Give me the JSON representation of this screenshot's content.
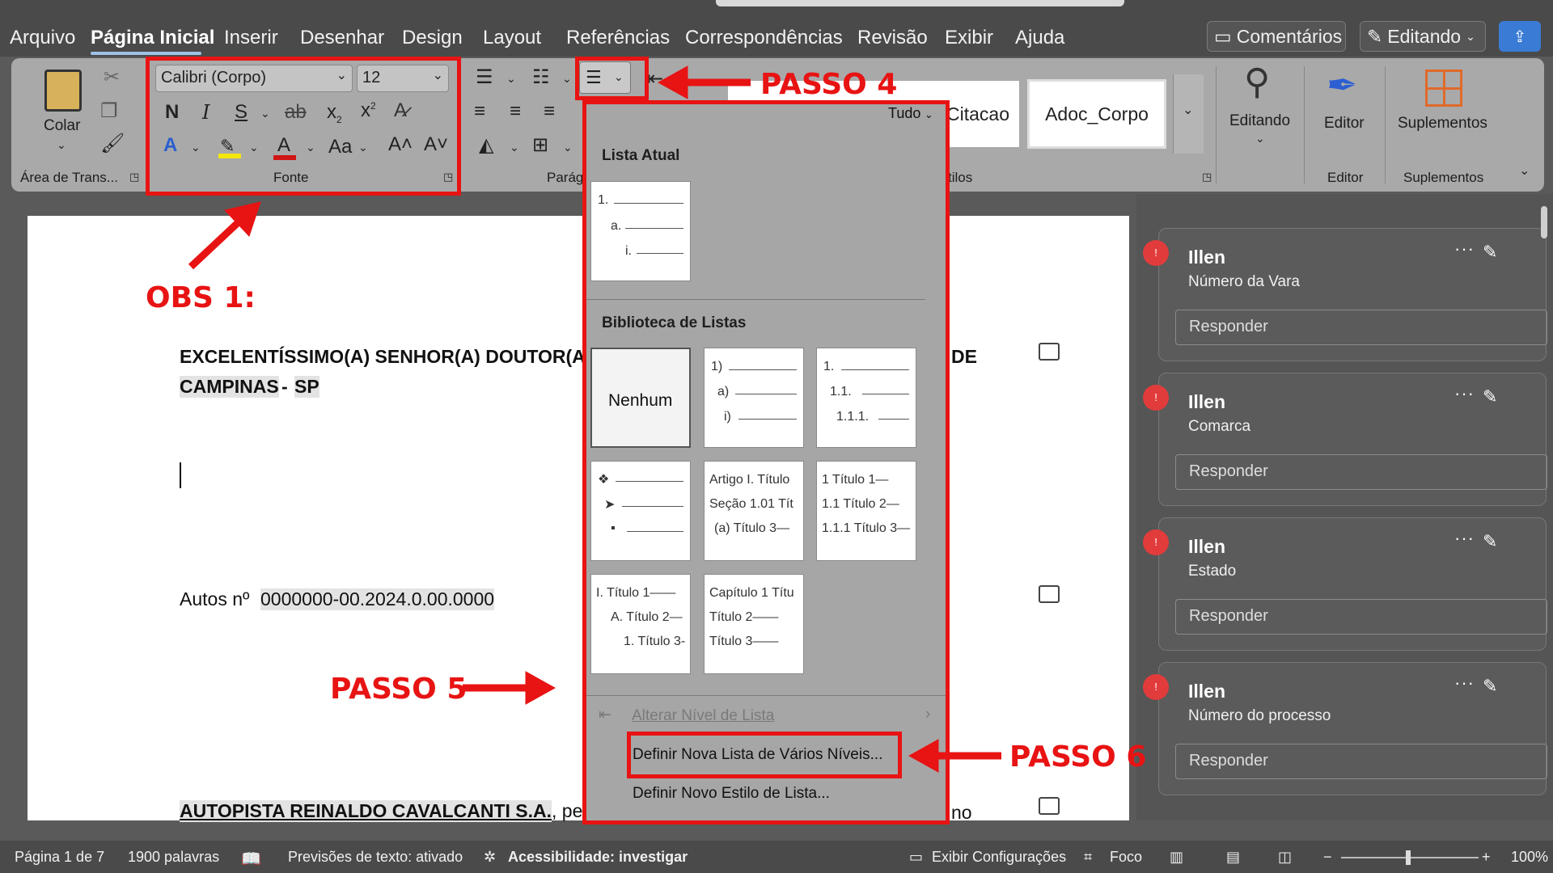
{
  "menu": {
    "tabs": [
      "Arquivo",
      "Página Inicial",
      "Inserir",
      "Desenhar",
      "Design",
      "Layout",
      "Referências",
      "Correspondências",
      "Revisão",
      "Exibir",
      "Ajuda"
    ],
    "comments_label": "Comentários",
    "editing_label": "Editando"
  },
  "ribbon": {
    "paste_label": "Colar",
    "clipboard_group": "Área de Trans...",
    "font_name": "Calibri (Corpo)",
    "font_size": "12",
    "font_group": "Fonte",
    "paragraph_group": "Parág",
    "styles_group_partial": "tilos",
    "style_citacao": "Citacao",
    "style_adoc": "Adoc_Corpo",
    "editing_label": "Editando",
    "editor_label": "Editor",
    "editor_group": "Editor",
    "addins_label": "Suplementos",
    "addins_group": "Suplementos"
  },
  "dropdown": {
    "filter": "Tudo",
    "current_list_title": "Lista Atual",
    "library_title": "Biblioteca de Listas",
    "none_label": "Nenhum",
    "current_tile": [
      "1.",
      "a.",
      "i."
    ],
    "tile_paren": [
      "1)",
      "a)",
      "i)"
    ],
    "tile_decimal": [
      "1.",
      "1.1.",
      "1.1.1."
    ],
    "tile_article": [
      "Artigo I. Título",
      "Seção 1.01 Tít",
      "(a) Título 3—"
    ],
    "tile_heading_num": [
      "1 Título 1—",
      "1.1 Título 2—",
      "1.1.1 Título 3—"
    ],
    "tile_roman": [
      "I. Título 1——",
      "A. Título 2—",
      "1. Título 3-"
    ],
    "tile_chapter": [
      "Capítulo 1 Títu",
      "Título 2——",
      "Título 3——"
    ],
    "change_level": "Alterar Nível de Lista",
    "define_multilevel": "Definir Nova Lista de Vários Níveis...",
    "define_style": "Definir Novo Estilo de Lista..."
  },
  "document": {
    "heading_line1_left": "EXCELENTÍSSIMO(A) SENHOR(A) DOUTOR(A)",
    "heading_line1_right": "DE",
    "heading_line2": "CAMPINAS",
    "heading_line2_sep": "-",
    "heading_line2_sp": "SP",
    "autos_label": "Autos nº",
    "autos_number": "0000000-00.2024.0.00.0000",
    "party": "AUTOPISTA REINALDO CAVALCANTI S.A.",
    "party_after": ", pe",
    "right_fragment": "no"
  },
  "comments": [
    {
      "author": "Illen",
      "text": "Número da Vara",
      "reply": "Responder"
    },
    {
      "author": "Illen",
      "text": "Comarca",
      "reply": "Responder"
    },
    {
      "author": "Illen",
      "text": "Estado",
      "reply": "Responder"
    },
    {
      "author": "Illen",
      "text": "Número do processo",
      "reply": "Responder"
    }
  ],
  "status": {
    "page": "Página 1 de 7",
    "words": "1900 palavras",
    "predictions": "Previsões de texto: ativado",
    "accessibility": "Acessibilidade: investigar",
    "display_settings": "Exibir Configurações",
    "focus": "Foco",
    "zoom": "100%"
  },
  "annotations": {
    "obs1": "OBS 1:",
    "passo4": "PASSO 4",
    "passo5": "PASSO 5",
    "passo6": "PASSO 6"
  },
  "colors": {
    "annotation_red": "#e81313",
    "accent_blue": "#3a7bd5",
    "comment_dot": "#e23b3b"
  }
}
